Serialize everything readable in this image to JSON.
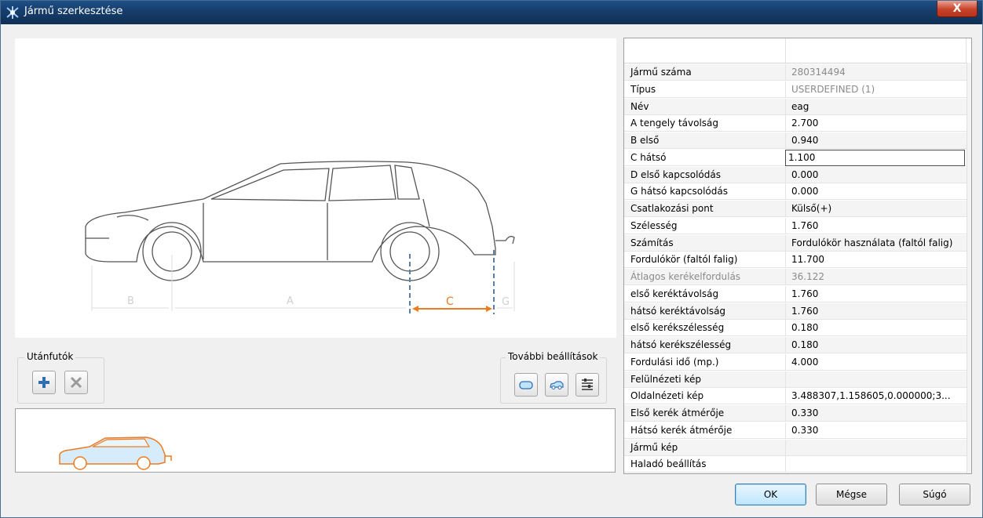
{
  "window": {
    "title": "Jármű szerkesztése",
    "close_label": "X"
  },
  "diagram": {
    "labels": {
      "a": "A",
      "b": "B",
      "c": "C",
      "g": "G"
    },
    "highlight_color": "#ee7b22"
  },
  "trailers": {
    "label": "Utánfutók"
  },
  "more_settings": {
    "label": "További beállítások"
  },
  "properties": [
    {
      "name": "Jármű száma",
      "value": "280314494",
      "muted_value": true
    },
    {
      "name": "Típus",
      "value": "USERDEFINED (1)",
      "muted_value": true
    },
    {
      "name": "Név",
      "value": "eag"
    },
    {
      "name": "A tengely távolság",
      "value": "2.700"
    },
    {
      "name": "B első",
      "value": "0.940"
    },
    {
      "name": "C hátsó",
      "value": "1.100",
      "editing": true
    },
    {
      "name": "D első kapcsolódás",
      "value": "0.000"
    },
    {
      "name": "G hátsó kapcsolódás",
      "value": "0.000"
    },
    {
      "name": "Csatlakozási pont",
      "value": "Külső(+)"
    },
    {
      "name": "Szélesség",
      "value": "1.760"
    },
    {
      "name": "Számítás",
      "value": "Fordulókör használata (faltól falig)"
    },
    {
      "name": "Fordulókör (faltól falig)",
      "value": "11.700"
    },
    {
      "name": "Átlagos kerékelfordulás",
      "value": "36.122",
      "muted_name": true,
      "muted_value": true
    },
    {
      "name": "első keréktávolság",
      "value": "1.760"
    },
    {
      "name": "hátsó keréktávolság",
      "value": "1.760"
    },
    {
      "name": "első kerékszélesség",
      "value": "0.180"
    },
    {
      "name": "hátsó kerékszélesség",
      "value": "0.180"
    },
    {
      "name": "Fordulási idő (mp.)",
      "value": "4.000"
    },
    {
      "name": "Felülnézeti kép",
      "value": ""
    },
    {
      "name": "Oldalnézeti kép",
      "value": "3.488307,1.158605,0.000000;3..."
    },
    {
      "name": "Első kerék átmérője",
      "value": "0.330"
    },
    {
      "name": "Hátsó kerék átmérője",
      "value": "0.330"
    },
    {
      "name": "Jármű kép",
      "value": ""
    },
    {
      "name": "Haladó beállítás",
      "value": ""
    }
  ],
  "buttons": {
    "ok": "OK",
    "cancel": "Mégse",
    "help": "Súgó"
  }
}
